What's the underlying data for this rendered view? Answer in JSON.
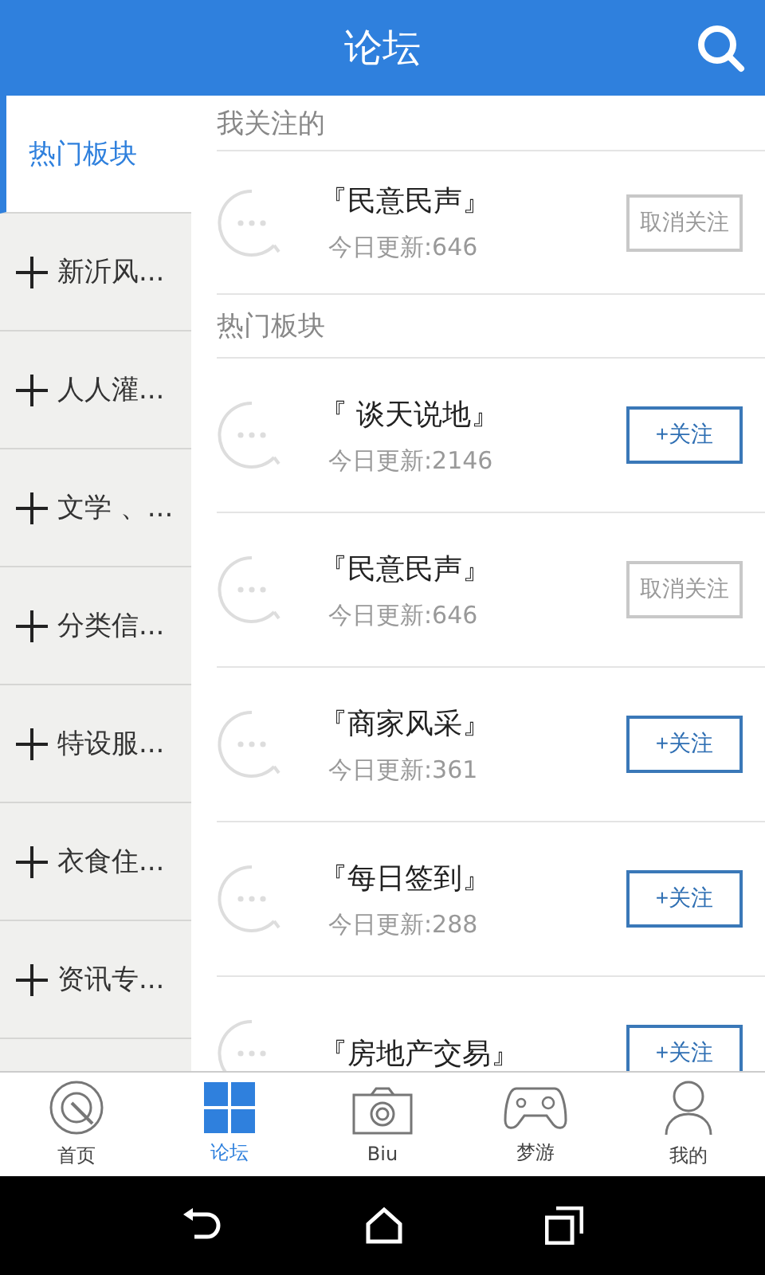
{
  "header": {
    "title": "论坛"
  },
  "sidebar": {
    "items": [
      {
        "label": "热门板块",
        "selected": true
      },
      {
        "label": "新沂风...",
        "selected": false
      },
      {
        "label": "人人灌...",
        "selected": false
      },
      {
        "label": "文学 、...",
        "selected": false
      },
      {
        "label": "分类信...",
        "selected": false
      },
      {
        "label": "特设服...",
        "selected": false
      },
      {
        "label": "衣食住...",
        "selected": false
      },
      {
        "label": "资讯专...",
        "selected": false
      }
    ]
  },
  "sections": [
    {
      "title": "我关注的",
      "boards": [
        {
          "name": "『民意民声』",
          "count": "今日更新:646",
          "followed": true,
          "button": "取消关注"
        }
      ]
    },
    {
      "title": "热门板块",
      "boards": [
        {
          "name": "『 谈天说地』",
          "count": "今日更新:2146",
          "followed": false,
          "button": "+关注"
        },
        {
          "name": "『民意民声』",
          "count": "今日更新:646",
          "followed": true,
          "button": "取消关注"
        },
        {
          "name": "『商家风采』",
          "count": "今日更新:361",
          "followed": false,
          "button": "+关注"
        },
        {
          "name": "『每日签到』",
          "count": "今日更新:288",
          "followed": false,
          "button": "+关注"
        },
        {
          "name": "『房地产交易』",
          "followed": false,
          "button": "+关注"
        }
      ]
    }
  ],
  "tabbar": [
    {
      "kind": "home",
      "label": "首页",
      "selected": false
    },
    {
      "kind": "forum",
      "label": "论坛",
      "selected": true
    },
    {
      "kind": "camera",
      "label": "Biu",
      "selected": false
    },
    {
      "kind": "game",
      "label": "梦游",
      "selected": false
    },
    {
      "kind": "user",
      "label": "我的",
      "selected": false
    }
  ]
}
